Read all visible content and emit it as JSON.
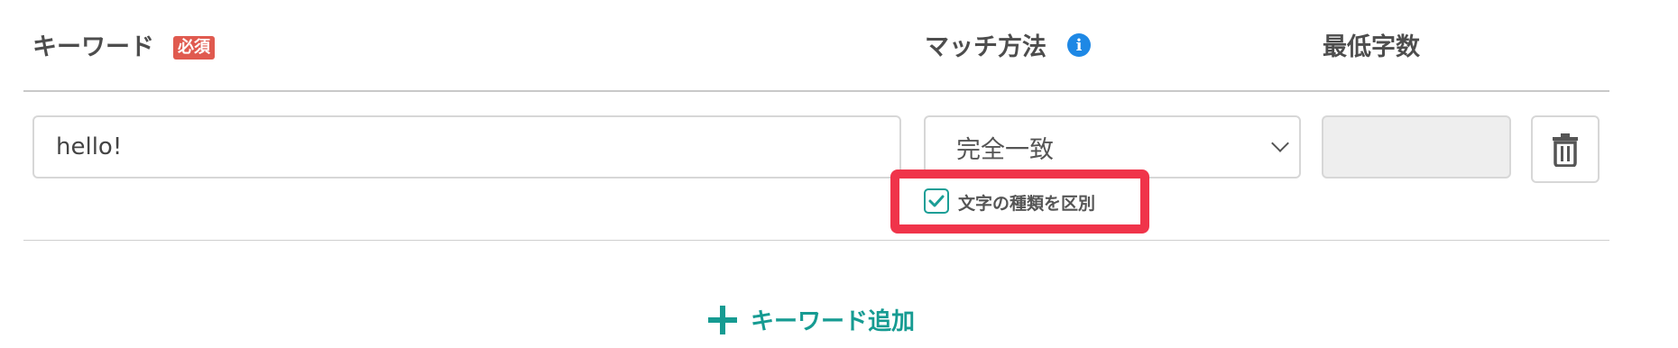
{
  "header": {
    "keyword_label": "キーワード",
    "required_badge": "必須",
    "match_label": "マッチ方法",
    "min_chars_label": "最低字数"
  },
  "row": {
    "keyword_value": "hello!",
    "match_selected": "完全一致",
    "case_checkbox": {
      "label": "文字の種類を区別",
      "checked": true
    },
    "min_chars_value": ""
  },
  "add_keyword": {
    "label": "キーワード追加"
  },
  "colors": {
    "accent": "#169b92",
    "info": "#1e88e5",
    "required": "#e05a4f",
    "highlight": "#f0344a"
  }
}
